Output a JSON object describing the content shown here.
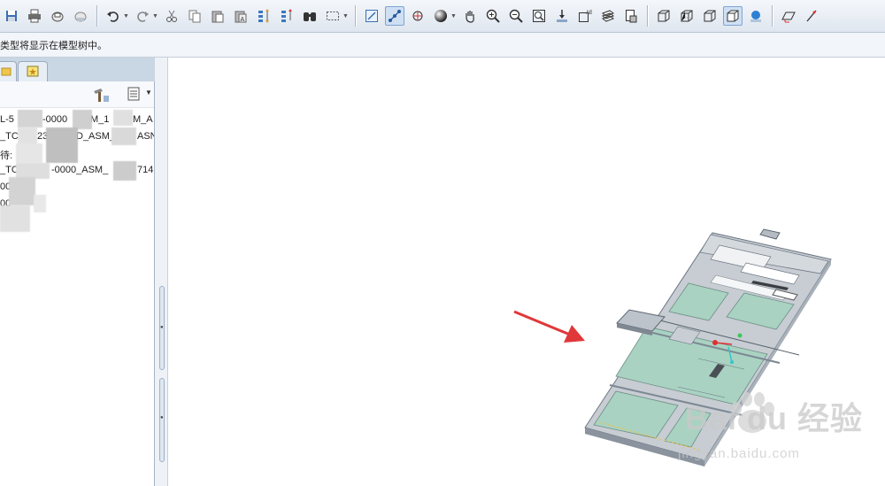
{
  "message_bar": {
    "text": "类型将显示在模型树中。"
  },
  "model_tree": {
    "rows": [
      {
        "label": "L-5",
        "mid": "-0000",
        "tail": "M_1",
        "end": "M_A"
      },
      {
        "label": "_TC",
        "mid": "23",
        "tail": "D_ASM_",
        "end": "ASN"
      },
      {
        "label": "待:",
        "mid": "",
        "tail": "",
        "end": ""
      },
      {
        "label": "_TC",
        "mid": "-0000_ASM_",
        "tail": "",
        "end": "714"
      },
      {
        "label": "000",
        "mid": "",
        "tail": "",
        "end": ""
      },
      {
        "label": "00",
        "mid": "",
        "tail": "",
        "end": ""
      }
    ]
  },
  "watermark": {
    "brand": "Bai du 经验",
    "url": "jingyan.baidu.com"
  },
  "colors": {
    "toolbar": "#dfe6ef",
    "arrow": "#e0383a",
    "part": "#a9d2c2",
    "frame": "#c7cdd3"
  }
}
